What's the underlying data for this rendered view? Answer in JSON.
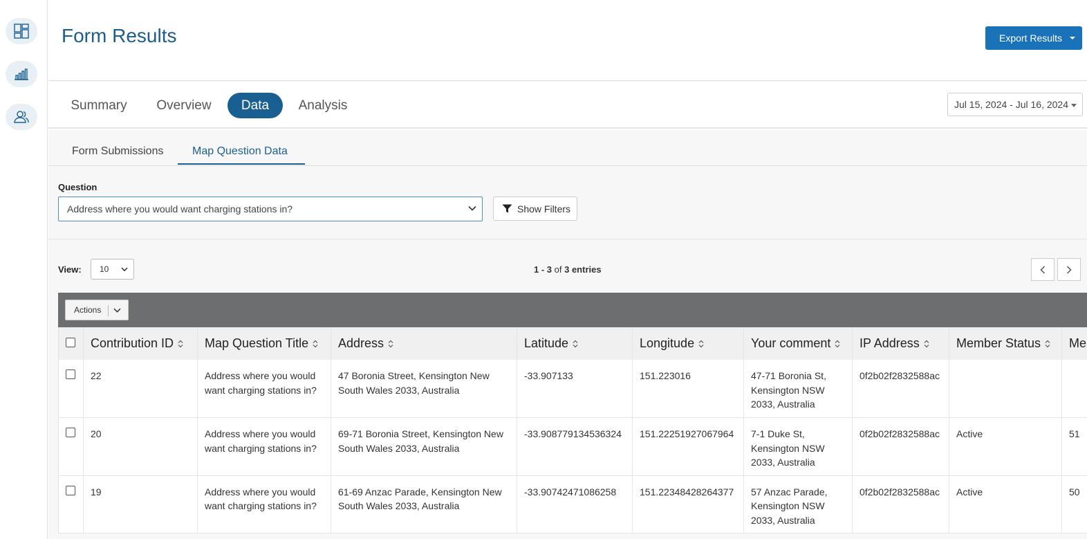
{
  "rail": {
    "items": [
      {
        "name": "dashboard-icon"
      },
      {
        "name": "bar-chart-icon"
      },
      {
        "name": "users-icon"
      }
    ]
  },
  "header": {
    "title": "Form Results",
    "export_label": "Export Results"
  },
  "tabs": [
    {
      "label": "Summary",
      "active": false
    },
    {
      "label": "Overview",
      "active": false
    },
    {
      "label": "Data",
      "active": true
    },
    {
      "label": "Analysis",
      "active": false
    }
  ],
  "date_range": "Jul 15, 2024 - Jul 16, 2024",
  "subtabs": [
    {
      "label": "Form Submissions",
      "active": false
    },
    {
      "label": "Map Question Data",
      "active": true
    }
  ],
  "question": {
    "label": "Question",
    "value": "Address where you would want charging stations in?"
  },
  "filters_label": "Show Filters",
  "view": {
    "label": "View:",
    "value": "10"
  },
  "entries": {
    "range": "1 - 3",
    "of": "of",
    "total": "3 entries"
  },
  "actions_label": "Actions",
  "table": {
    "columns": [
      "Contribution ID",
      "Map Question Title",
      "Address",
      "Latitude",
      "Longitude",
      "Your comment",
      "IP Address",
      "Member Status",
      "Me"
    ],
    "rows": [
      [
        "22",
        "Address where you would want charging stations in?",
        "47 Boronia Street, Kensington New South Wales 2033, Australia",
        "-33.907133",
        "151.223016",
        "47-71 Boronia St, Kensington NSW 2033, Australia",
        "0f2b02f2832588ac",
        "",
        ""
      ],
      [
        "20",
        "Address where you would want charging stations in?",
        "69-71 Boronia Street, Kensington New South Wales 2033, Australia",
        "-33.908779134536324",
        "151.22251927067964",
        "7-1 Duke St, Kensington NSW 2033, Australia",
        "0f2b02f2832588ac",
        "Active",
        "51"
      ],
      [
        "19",
        "Address where you would want charging stations in?",
        "61-69 Anzac Parade, Kensington New South Wales 2033, Australia",
        "-33.90742471086258",
        "151.22348428264377",
        "57 Anzac Parade, Kensington NSW 2033, Australia",
        "0f2b02f2832588ac",
        "Active",
        "50"
      ]
    ]
  },
  "colors": {
    "brand": "#1a5f91",
    "accent_button": "#1a73b8",
    "actions_bar": "#6d6e70"
  }
}
